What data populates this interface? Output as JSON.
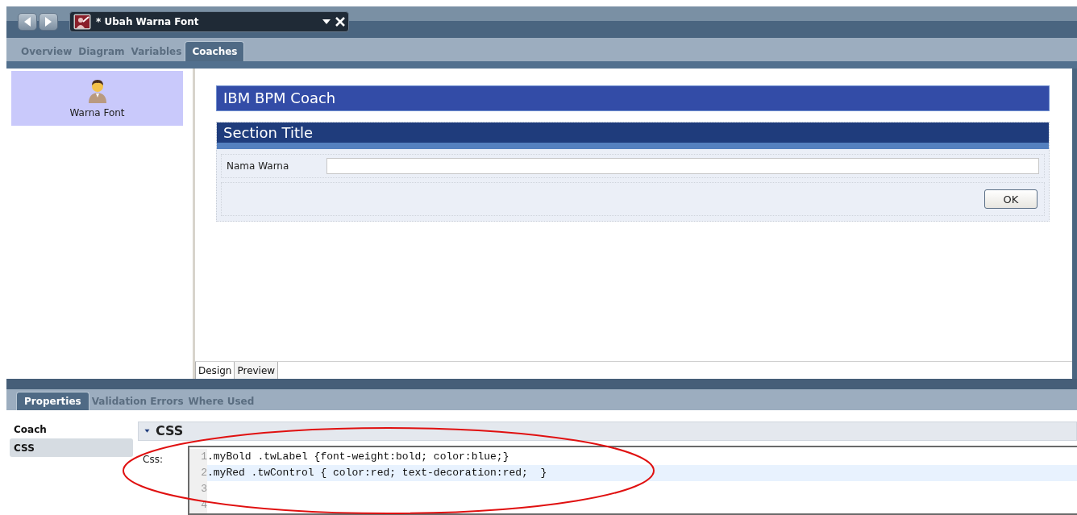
{
  "window": {
    "title": "* Ubah Warna Font"
  },
  "editor_tabs": [
    {
      "label": "Overview",
      "selected": false
    },
    {
      "label": "Diagram",
      "selected": false
    },
    {
      "label": "Variables",
      "selected": false
    },
    {
      "label": "Coaches",
      "selected": true
    }
  ],
  "coaches": [
    {
      "label": "Warna Font",
      "selected": true
    }
  ],
  "coach": {
    "title": "IBM BPM Coach",
    "section_title": "Section Title",
    "fields": [
      {
        "label": "Nama Warna"
      }
    ],
    "buttons": [
      "OK"
    ]
  },
  "view_tabs": [
    {
      "label": "Design",
      "selected": true
    },
    {
      "label": "Preview",
      "selected": false
    }
  ],
  "panel_tabs": [
    {
      "label": "Properties",
      "selected": true
    },
    {
      "label": "Validation Errors",
      "selected": false
    },
    {
      "label": "Where Used",
      "selected": false
    }
  ],
  "properties_nav": [
    {
      "label": "Coach",
      "selected": false
    },
    {
      "label": "CSS",
      "selected": true
    }
  ],
  "css_section": {
    "title": "CSS",
    "expanded": true,
    "field_label": "Css:",
    "lines": [
      {
        "number": "1",
        "text": ".myBold .twLabel {font-weight:bold; color:blue;}",
        "current": false
      },
      {
        "number": "2",
        "text": ".myRed .twControl { color:red; text-decoration:red;  }",
        "current": true
      },
      {
        "number": "3",
        "current": false
      },
      {
        "number": "4",
        "current": false
      }
    ]
  }
}
